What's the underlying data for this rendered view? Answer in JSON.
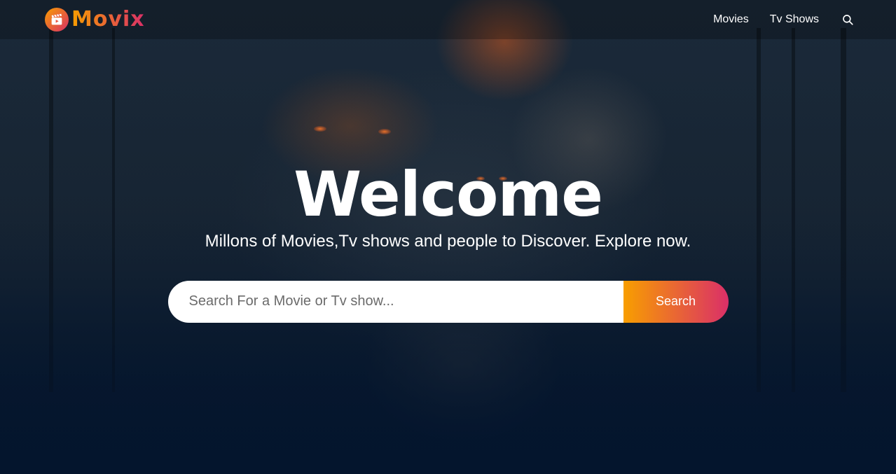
{
  "header": {
    "logo_text": "Movix",
    "nav": [
      {
        "label": "Movies"
      },
      {
        "label": "Tv Shows"
      }
    ],
    "search_icon": "search-icon"
  },
  "hero": {
    "title": "Welcome",
    "subtitle": "Millons of Movies,Tv shows and people to Discover. Explore now.",
    "search": {
      "placeholder": "Search For a Movie or Tv show...",
      "button_label": "Search"
    }
  },
  "colors": {
    "gradient_start": "#f89e00",
    "gradient_end": "#da2f68",
    "page_background": "#04152d"
  }
}
